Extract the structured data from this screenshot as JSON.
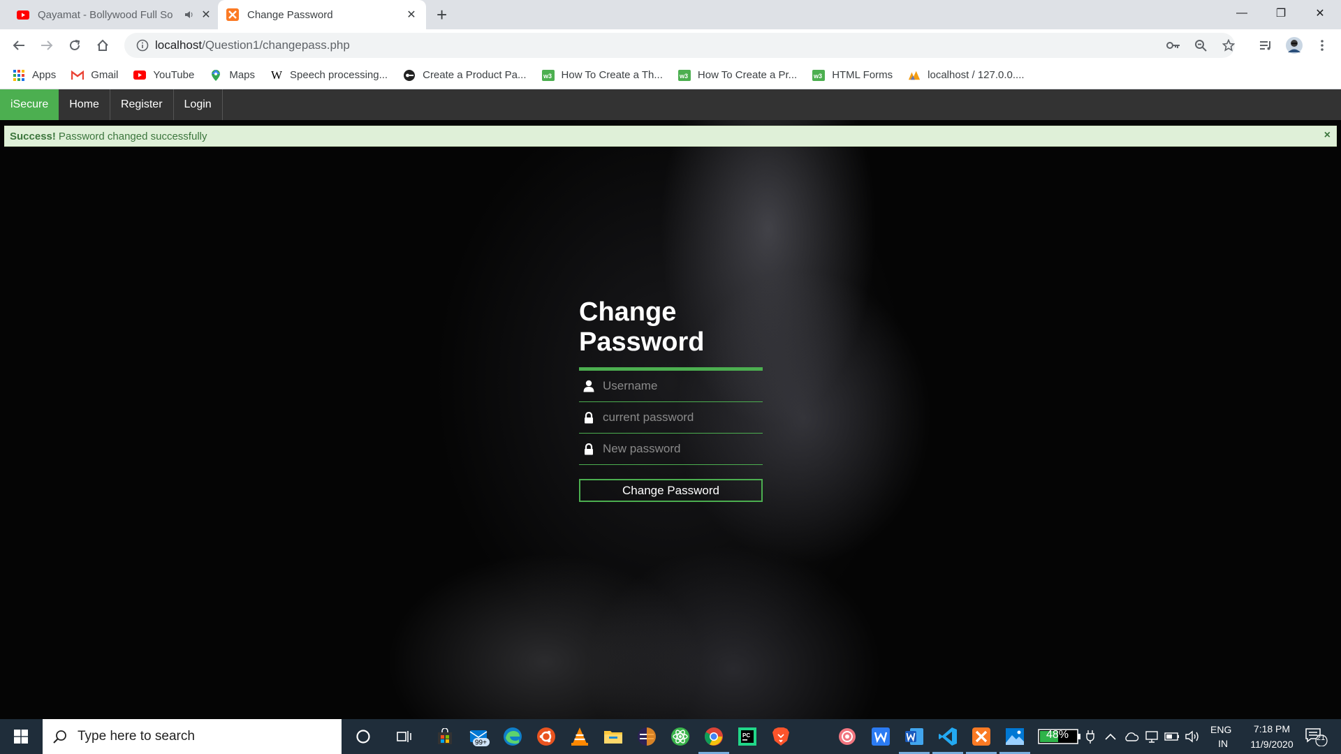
{
  "browser": {
    "tabs": [
      {
        "title": "Qayamat - Bollywood Full So",
        "active": false,
        "audio": true
      },
      {
        "title": "Change Password",
        "active": true
      }
    ],
    "url_host": "localhost",
    "url_path": "/Question1/changepass.php",
    "bookmarks": [
      {
        "label": "Apps",
        "icon": "apps-grid-icon"
      },
      {
        "label": "Gmail",
        "icon": "gmail-icon"
      },
      {
        "label": "YouTube",
        "icon": "youtube-icon"
      },
      {
        "label": "Maps",
        "icon": "maps-icon"
      },
      {
        "label": "Speech processing...",
        "icon": "wikipedia-icon"
      },
      {
        "label": "Create a Product Pa...",
        "icon": "site-icon"
      },
      {
        "label": "How To Create a Th...",
        "icon": "w3schools-icon"
      },
      {
        "label": "How To Create a Pr...",
        "icon": "w3schools-icon"
      },
      {
        "label": "HTML Forms",
        "icon": "w3schools-icon"
      },
      {
        "label": "localhost / 127.0.0....",
        "icon": "phpmyadmin-icon"
      }
    ]
  },
  "site": {
    "nav": [
      {
        "label": "iSecure"
      },
      {
        "label": "Home"
      },
      {
        "label": "Register"
      },
      {
        "label": "Login"
      }
    ],
    "alert": {
      "strong": "Success!",
      "message": "Password changed successfully",
      "close": "×"
    },
    "form": {
      "title": "Change Password",
      "username_placeholder": "Username",
      "current_placeholder": "current password",
      "new_placeholder": "New password",
      "submit_label": "Change Password"
    },
    "accent_color": "#4caf50"
  },
  "taskbar": {
    "search_placeholder": "Type here to search",
    "mail_badge": "99+",
    "battery": "48%",
    "lang_line1": "ENG",
    "lang_line2": "IN",
    "time": "7:18 PM",
    "date": "11/9/2020",
    "notifications": "21"
  }
}
